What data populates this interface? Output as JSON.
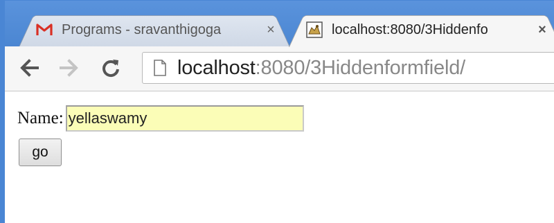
{
  "browser": {
    "tabs": [
      {
        "title": "Programs - sravanthigoga",
        "favicon": "gmail-icon",
        "active": false,
        "close_label": "×"
      },
      {
        "title": "localhost:8080/3Hiddenfo",
        "favicon": "tomcat-icon",
        "active": true,
        "close_label": "×"
      }
    ],
    "address": {
      "host": "localhost",
      "rest": ":8080/3Hiddenformfield/"
    }
  },
  "page": {
    "form": {
      "name_label": "Name:",
      "name_value": "yellaswamy",
      "submit_label": "go"
    }
  },
  "colors": {
    "window_frame": "#4a86d4",
    "input_autofill_bg": "#fbfdb7",
    "gmail_red": "#d93025"
  }
}
